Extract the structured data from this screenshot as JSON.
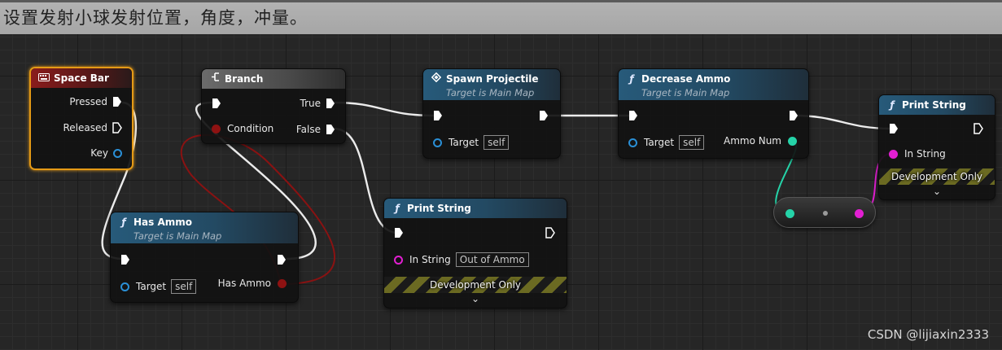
{
  "caption": "设置发射小球发射位置，角度，冲量。",
  "colors": {
    "exec_wire": "#e8e8e8",
    "bool_pin": "#8e1212",
    "object_pin": "#2a8fd6",
    "string_pin": "#e21fd2",
    "int_pin": "#25d3a8",
    "selection": "#e59a16"
  },
  "nodes": {
    "space_bar": {
      "icon": "keyboard-icon",
      "title": "Space Bar",
      "pressed": "Pressed",
      "released": "Released",
      "key": "Key"
    },
    "branch": {
      "icon": "branch-icon",
      "title": "Branch",
      "condition": "Condition",
      "true_label": "True",
      "false_label": "False"
    },
    "spawn_projectile": {
      "icon": "event-diamond-icon",
      "title": "Spawn Projectile",
      "subtitle": "Target is Main Map",
      "target_label": "Target",
      "target_value": "self"
    },
    "decrease_ammo": {
      "icon": "function-icon",
      "title": "Decrease Ammo",
      "subtitle": "Target is Main Map",
      "target_label": "Target",
      "target_value": "self",
      "ammo_num": "Ammo Num"
    },
    "print_string_1": {
      "icon": "function-icon",
      "title": "Print String",
      "in_string": "In String",
      "dev_only": "Development Only"
    },
    "has_ammo": {
      "icon": "function-icon",
      "title": "Has Ammo",
      "subtitle": "Target is Main Map",
      "target_label": "Target",
      "target_value": "self",
      "has_ammo": "Has Ammo"
    },
    "print_string_2": {
      "icon": "function-icon",
      "title": "Print String",
      "in_string": "In String",
      "in_string_value": "Out of Ammo",
      "dev_only": "Development Only"
    }
  },
  "watermark": "CSDN @lijiaxin2333"
}
